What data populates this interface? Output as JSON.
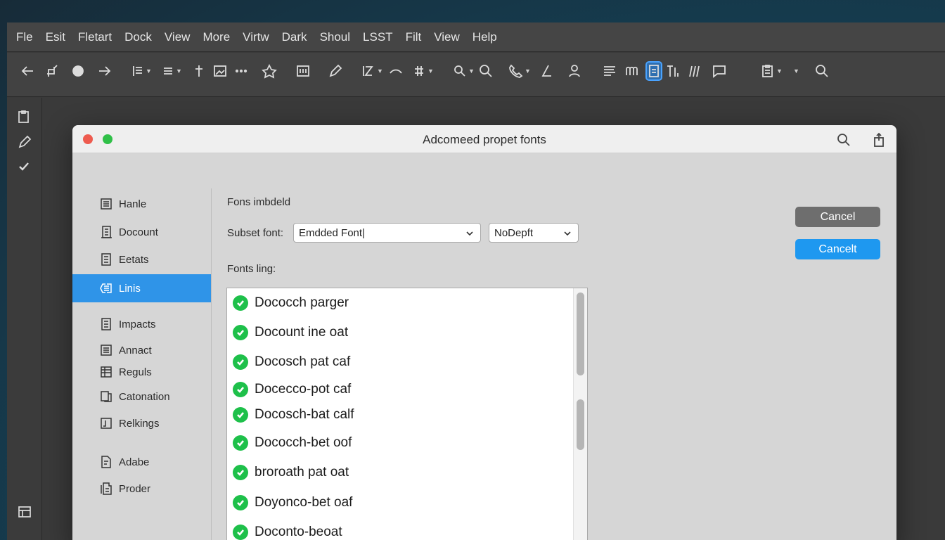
{
  "menubar": {
    "items": [
      "Fle",
      "Esit",
      "Fletart",
      "Dock",
      "View",
      "More",
      "Virtw",
      "Dark",
      "Shoul",
      "LSST",
      "Filt",
      "View",
      "Help"
    ]
  },
  "toolbar": {
    "icons": [
      "arrow-left-icon",
      "crop-icon",
      "shape-icon",
      "arrow-right-icon",
      "align-icon",
      "list-icon",
      "pin-icon",
      "image-icon",
      "more-icon",
      "stamp-icon",
      "scan-icon",
      "pen-icon",
      "text-size-icon",
      "curve-icon",
      "grid-icon",
      "zoom-icon",
      "search-icon",
      "phone-icon",
      "pencil-icon",
      "person-icon",
      "lines-icon",
      "columns-icon",
      "page-icon",
      "text-cursor-icon",
      "strokes-icon",
      "comment-icon",
      "clipboard-icon",
      "magnify-icon"
    ],
    "active_icon": "page-icon"
  },
  "sidestrip": {
    "icons": [
      "clipboard-icon",
      "pen-icon",
      "check-icon",
      "panel-icon"
    ]
  },
  "dialog": {
    "title": "Adcomeed propet fonts",
    "nav_items": [
      {
        "label": "Hanle",
        "icon": "book-icon"
      },
      {
        "label": "Docount",
        "icon": "building-icon"
      },
      {
        "label": "Eetats",
        "icon": "document-icon"
      },
      {
        "label": "Linis",
        "icon": "link-icon",
        "selected": true
      },
      {
        "label": "Impacts",
        "icon": "document-icon"
      },
      {
        "label": "Annact",
        "icon": "document-icon"
      },
      {
        "label": "Reguls",
        "icon": "table-icon"
      },
      {
        "label": "Catonation",
        "icon": "copy-icon"
      },
      {
        "label": "Relkings",
        "icon": "frame-icon"
      },
      {
        "label": "Adabe",
        "icon": "doc-edit-icon"
      },
      {
        "label": "Proder",
        "icon": "doc-stack-icon"
      }
    ],
    "section_label": "Fons imbdeld",
    "subset_label": "Subset font:",
    "subset_value": "Emdded Font|",
    "second_value": "NoDepft",
    "font_listing_label": "Fonts ling:",
    "fonts": [
      "Dococch parger",
      "Docount ine oat",
      "Docosch pat caf",
      "Docecco-pot caf",
      "Docosch-bat calf",
      "Dococch-bet oof",
      "broroath pat oat",
      "Doyonco-bet oaf",
      "Doconto-beoat"
    ],
    "buttons": {
      "cancel_label": "Cancel",
      "cancel2_label": "Cancelt"
    }
  },
  "colors": {
    "selected_nav": "#2f94e8",
    "primary_button": "#1e98f0",
    "secondary_button": "#6e6e6e",
    "check": "#1ec04a"
  }
}
